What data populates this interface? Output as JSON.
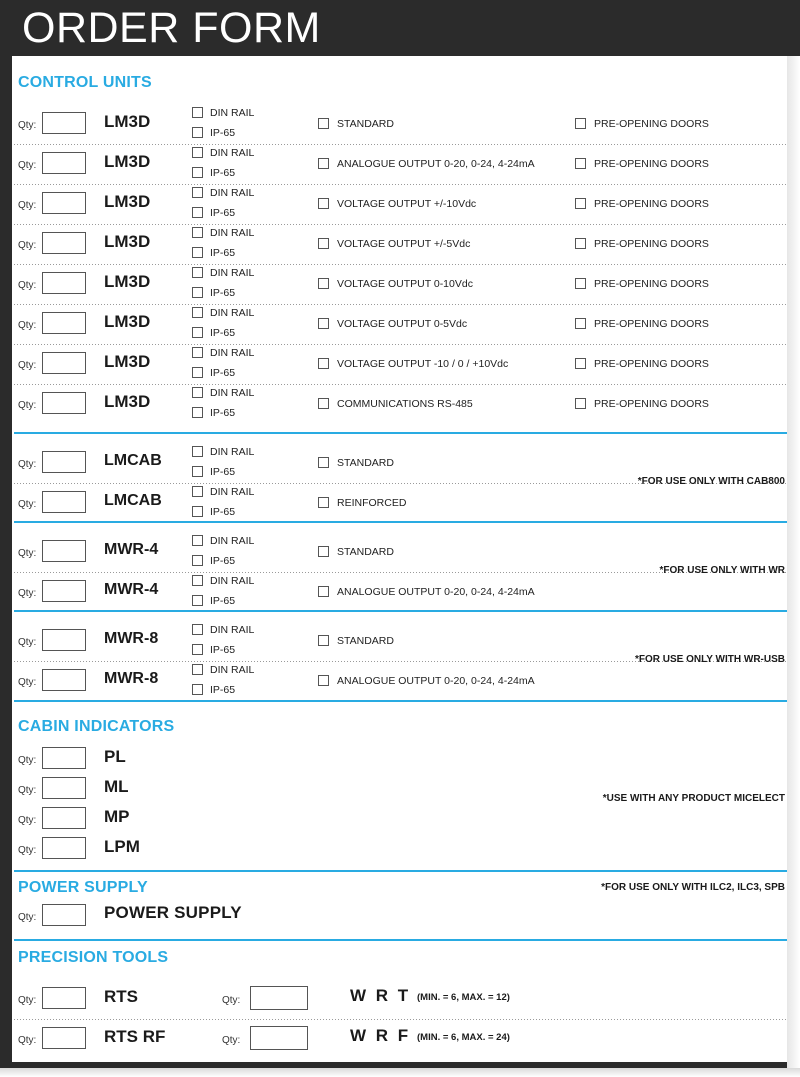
{
  "header": {
    "title": "ORDER FORM"
  },
  "sections": [
    {
      "id": "control-units",
      "title": "CONTROL UNITS"
    },
    {
      "id": "cabin-indicators",
      "title": "CABIN INDICATORS"
    },
    {
      "id": "power-supply",
      "title": "POWER SUPPLY"
    },
    {
      "id": "precision-tools",
      "title": "PRECISION TOOLS"
    }
  ],
  "labels": {
    "qty": "Qty:",
    "din_rail": "DIN RAIL",
    "ip65": "IP-65"
  },
  "colors": {
    "accent": "#29abe2",
    "header_band": "#2b2b2b",
    "text": "#1a1a1a"
  },
  "rows": {
    "lm3d": [
      {
        "model": "LM3D",
        "qty": "",
        "mount": [
          "DIN RAIL",
          "IP-65"
        ],
        "option": "STANDARD",
        "extra": "PRE-OPENING DOORS"
      },
      {
        "model": "LM3D",
        "qty": "",
        "mount": [
          "DIN RAIL",
          "IP-65"
        ],
        "option": "ANALOGUE OUTPUT 0-20, 0-24, 4-24mA",
        "extra": "PRE-OPENING DOORS"
      },
      {
        "model": "LM3D",
        "qty": "",
        "mount": [
          "DIN RAIL",
          "IP-65"
        ],
        "option": "VOLTAGE OUTPUT +/-10Vdc",
        "extra": "PRE-OPENING DOORS"
      },
      {
        "model": "LM3D",
        "qty": "",
        "mount": [
          "DIN RAIL",
          "IP-65"
        ],
        "option": "VOLTAGE OUTPUT +/-5Vdc",
        "extra": "PRE-OPENING DOORS"
      },
      {
        "model": "LM3D",
        "qty": "",
        "mount": [
          "DIN RAIL",
          "IP-65"
        ],
        "option": "VOLTAGE OUTPUT 0-10Vdc",
        "extra": "PRE-OPENING DOORS"
      },
      {
        "model": "LM3D",
        "qty": "",
        "mount": [
          "DIN RAIL",
          "IP-65"
        ],
        "option": "VOLTAGE OUTPUT 0-5Vdc",
        "extra": "PRE-OPENING DOORS"
      },
      {
        "model": "LM3D",
        "qty": "",
        "mount": [
          "DIN RAIL",
          "IP-65"
        ],
        "option": "VOLTAGE OUTPUT -10 / 0 / +10Vdc",
        "extra": "PRE-OPENING DOORS"
      },
      {
        "model": "LM3D",
        "qty": "",
        "mount": [
          "DIN RAIL",
          "IP-65"
        ],
        "option": "COMMUNICATIONS RS-485",
        "extra": "PRE-OPENING DOORS"
      }
    ],
    "lmcab": [
      {
        "model": "LMCAB",
        "qty": "",
        "mount": [
          "DIN RAIL",
          "IP-65"
        ],
        "option": "STANDARD"
      },
      {
        "model": "LMCAB",
        "qty": "",
        "mount": [
          "DIN RAIL",
          "IP-65"
        ],
        "option": "REINFORCED"
      }
    ],
    "mwr4": [
      {
        "model": "MWR-4",
        "qty": "",
        "mount": [
          "DIN RAIL",
          "IP-65"
        ],
        "option": "STANDARD"
      },
      {
        "model": "MWR-4",
        "qty": "",
        "mount": [
          "DIN RAIL",
          "IP-65"
        ],
        "option": "ANALOGUE OUTPUT 0-20, 0-24, 4-24mA"
      }
    ],
    "mwr8": [
      {
        "model": "MWR-8",
        "qty": "",
        "mount": [
          "DIN RAIL",
          "IP-65"
        ],
        "option": "STANDARD"
      },
      {
        "model": "MWR-8",
        "qty": "",
        "mount": [
          "DIN RAIL",
          "IP-65"
        ],
        "option": "ANALOGUE OUTPUT 0-20, 0-24, 4-24mA"
      }
    ],
    "cabin": [
      {
        "model": "PL",
        "qty": ""
      },
      {
        "model": "ML",
        "qty": ""
      },
      {
        "model": "MP",
        "qty": ""
      },
      {
        "model": "LPM",
        "qty": ""
      }
    ],
    "power": [
      {
        "model": "POWER SUPPLY",
        "qty": ""
      }
    ],
    "precision": [
      {
        "model": "RTS",
        "qty": "",
        "model2": "W R T",
        "qty2": "",
        "minmax": "(MIN. = 6, MAX. = 12)"
      },
      {
        "model": "RTS RF",
        "qty": "",
        "model2": "W R F",
        "qty2": "",
        "minmax": "(MIN. = 6, MAX. = 24)"
      }
    ]
  },
  "notes": {
    "lmcab": "*FOR USE ONLY WITH CAB800",
    "mwr4": "*FOR USE ONLY WITH WR",
    "mwr8": "*FOR USE ONLY WITH WR-USB",
    "cabin": "*USE WITH ANY PRODUCT MICELECT",
    "power": "*FOR USE ONLY WITH ILC2, ILC3, SPB"
  }
}
